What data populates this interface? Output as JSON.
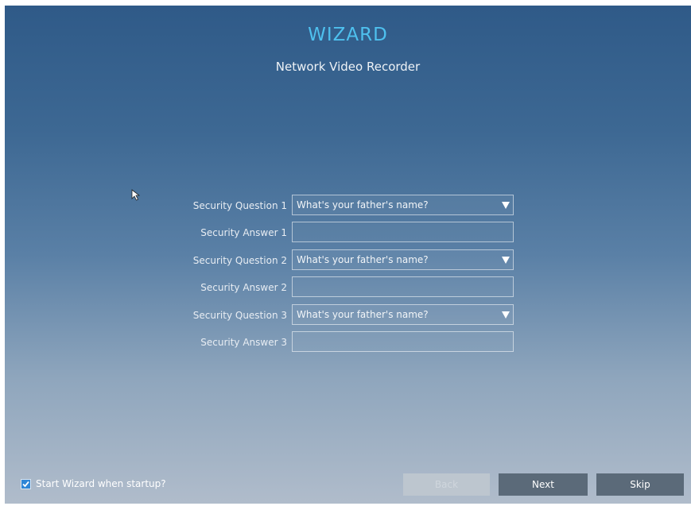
{
  "header": {
    "title": "WIZARD",
    "subtitle": "Network Video Recorder"
  },
  "form": {
    "rows": [
      {
        "label": "Security Question 1",
        "type": "select",
        "value": "What's your father's name?"
      },
      {
        "label": "Security Answer 1",
        "type": "input",
        "value": ""
      },
      {
        "label": "Security Question 2",
        "type": "select",
        "value": "What's your father's name?"
      },
      {
        "label": "Security Answer 2",
        "type": "input",
        "value": ""
      },
      {
        "label": "Security Question 3",
        "type": "select",
        "value": "What's your father's name?"
      },
      {
        "label": "Security Answer 3",
        "type": "input",
        "value": ""
      }
    ]
  },
  "footer": {
    "startup_checkbox_label": "Start Wizard when startup?",
    "startup_checked": true,
    "back_label": "Back",
    "next_label": "Next",
    "skip_label": "Skip"
  },
  "colors": {
    "title": "#4ec0ee",
    "checkbox": "#2f86d6",
    "button": "#5b6a79"
  }
}
